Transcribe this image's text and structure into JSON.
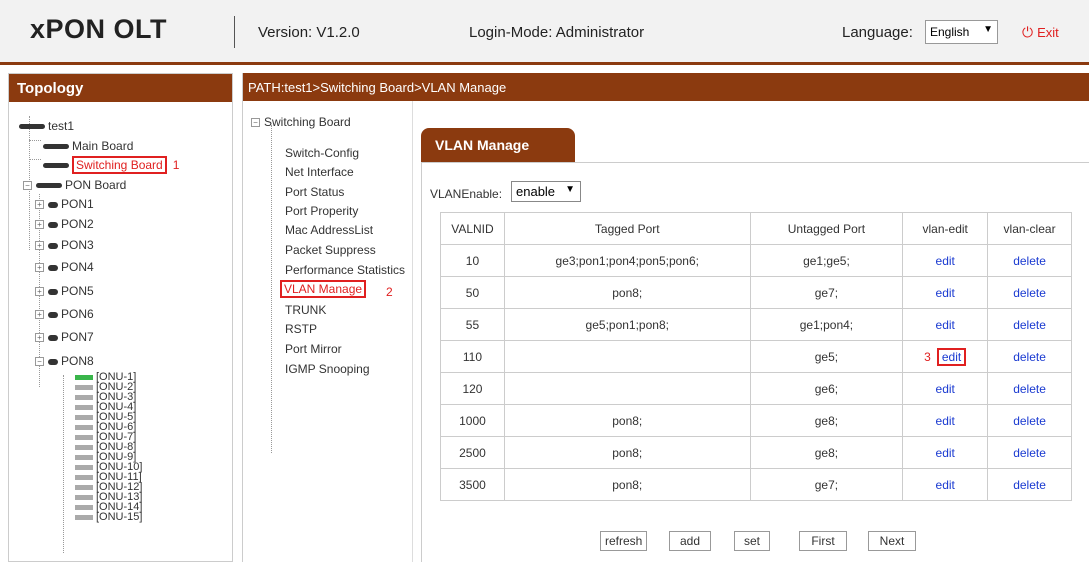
{
  "header": {
    "brand": "xPON OLT",
    "version": "Version: V1.2.0",
    "login_mode": "Login-Mode: Administrator",
    "language_label": "Language:",
    "language_value": "English",
    "exit_label": "Exit"
  },
  "topology": {
    "title": "Topology",
    "root": "test1",
    "main_board": "Main Board",
    "switching_board": "Switching Board",
    "switching_marker": "1",
    "pon_board": "PON Board",
    "pons": [
      "PON1",
      "PON2",
      "PON3",
      "PON4",
      "PON5",
      "PON6",
      "PON7",
      "PON8"
    ],
    "onus": [
      "[ONU-1]",
      "[ONU-2]",
      "[ONU-3]",
      "[ONU-4]",
      "[ONU-5]",
      "[ONU-6]",
      "[ONU-7]",
      "[ONU-8]",
      "[ONU-9]",
      "[ONU-10]",
      "[ONU-11]",
      "[ONU-12]",
      "[ONU-13]",
      "[ONU-14]",
      "[ONU-15]"
    ]
  },
  "path": "PATH:test1>Switching Board>VLAN Manage",
  "menu": {
    "root": "Switching Board",
    "items": [
      "Switch-Config",
      "Net Interface",
      "Port Status",
      "Port Properity",
      "Mac AddressList",
      "Packet Suppress",
      "Performance Statistics",
      "VLAN Manage",
      "TRUNK",
      "RSTP",
      "Port Mirror",
      "IGMP Snooping"
    ],
    "active_marker": "2"
  },
  "tab": {
    "label": "VLAN Manage"
  },
  "vlan_enable": {
    "label": "VLANEnable:",
    "value": "enable"
  },
  "table": {
    "headers": [
      "VALNID",
      "Tagged Port",
      "Untagged Port",
      "vlan-edit",
      "vlan-clear"
    ],
    "rows": [
      {
        "id": "10",
        "tagged": "ge3;pon1;pon4;pon5;pon6;",
        "untagged": "ge1;ge5;",
        "edit": "edit",
        "clear": "delete"
      },
      {
        "id": "50",
        "tagged": "pon8;",
        "untagged": "ge7;",
        "edit": "edit",
        "clear": "delete"
      },
      {
        "id": "55",
        "tagged": "ge5;pon1;pon8;",
        "untagged": "ge1;pon4;",
        "edit": "edit",
        "clear": "delete"
      },
      {
        "id": "110",
        "tagged": "",
        "untagged": "ge5;",
        "edit": "edit",
        "clear": "delete"
      },
      {
        "id": "120",
        "tagged": "",
        "untagged": "ge6;",
        "edit": "edit",
        "clear": "delete"
      },
      {
        "id": "1000",
        "tagged": "pon8;",
        "untagged": "ge8;",
        "edit": "edit",
        "clear": "delete"
      },
      {
        "id": "2500",
        "tagged": "pon8;",
        "untagged": "ge8;",
        "edit": "edit",
        "clear": "delete"
      },
      {
        "id": "3500",
        "tagged": "pon8;",
        "untagged": "ge7;",
        "edit": "edit",
        "clear": "delete"
      }
    ],
    "edit_marker": "3"
  },
  "buttons": {
    "refresh": "refresh",
    "add": "add",
    "set": "set",
    "first": "First",
    "next": "Next"
  }
}
